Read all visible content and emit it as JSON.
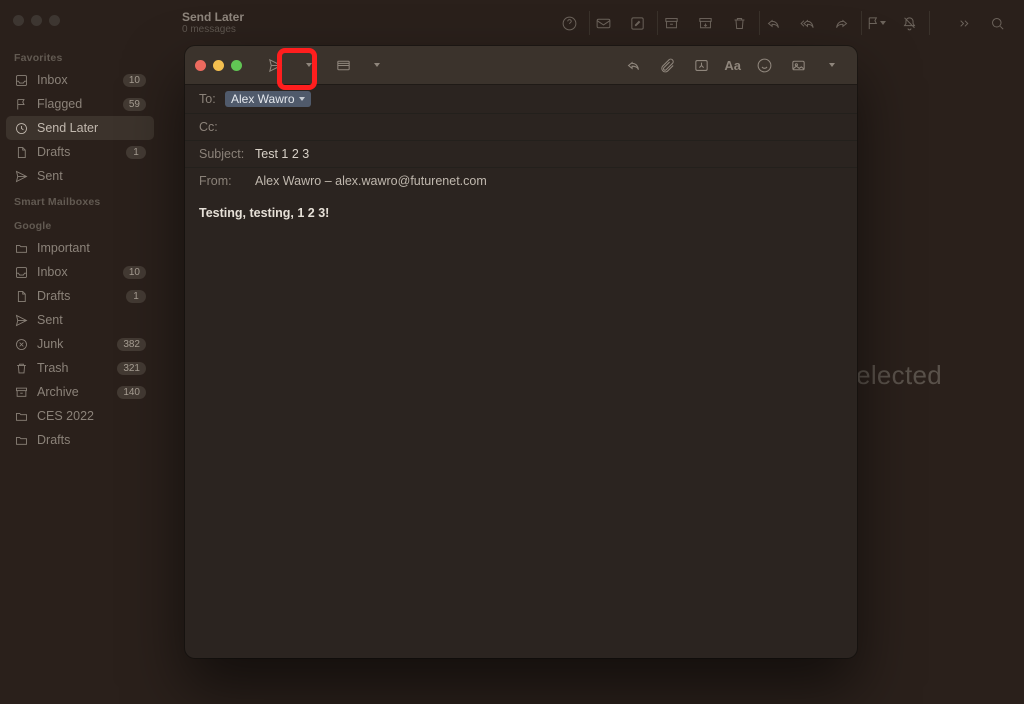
{
  "main_header": {
    "title": "Send Later",
    "subtitle": "0 messages"
  },
  "sidebar": {
    "sections": [
      {
        "label": "Favorites",
        "items": [
          {
            "icon": "inbox",
            "label": "Inbox",
            "badge": "10"
          },
          {
            "icon": "flag",
            "label": "Flagged",
            "badge": "59"
          },
          {
            "icon": "clock",
            "label": "Send Later",
            "selected": true
          },
          {
            "icon": "doc",
            "label": "Drafts",
            "badge": "1"
          },
          {
            "icon": "send",
            "label": "Sent"
          }
        ]
      },
      {
        "label": "Smart Mailboxes",
        "items": []
      },
      {
        "label": "Google",
        "items": [
          {
            "icon": "folder",
            "label": "Important"
          },
          {
            "icon": "inbox",
            "label": "Inbox",
            "badge": "10"
          },
          {
            "icon": "doc",
            "label": "Drafts",
            "badge": "1"
          },
          {
            "icon": "send",
            "label": "Sent"
          },
          {
            "icon": "junk",
            "label": "Junk",
            "badge": "382"
          },
          {
            "icon": "trash",
            "label": "Trash",
            "badge": "321"
          },
          {
            "icon": "archive",
            "label": "Archive",
            "badge": "140"
          },
          {
            "icon": "folder",
            "label": "CES 2022"
          },
          {
            "icon": "folder",
            "label": "Drafts"
          }
        ]
      }
    ]
  },
  "message_list_empty": "No Message Selected",
  "compose": {
    "to_label": "To:",
    "to_token": "Alex Wawro",
    "cc_label": "Cc:",
    "subject_label": "Subject:",
    "subject_value": "Test 1 2 3",
    "from_label": "From:",
    "from_value": "Alex Wawro – alex.wawro@futurenet.com",
    "body": "Testing, testing, 1 2  3!"
  }
}
